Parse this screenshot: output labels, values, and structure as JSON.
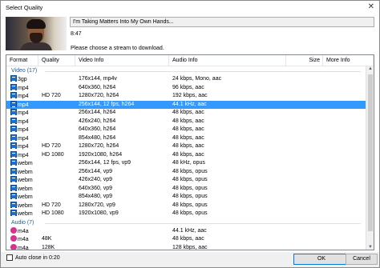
{
  "window": {
    "title": "Select Quality"
  },
  "video": {
    "title": "I'm Taking Matters Into My Own Hands...",
    "duration": "8:47",
    "prompt": "Please choose a stream to download."
  },
  "columns": [
    "Format",
    "Quality",
    "Video Info",
    "Audio Info",
    "Size",
    "More Info"
  ],
  "groups": [
    {
      "label": "Video (17)",
      "icon": "video-file-icon",
      "rows": [
        {
          "format": "3gp",
          "quality": "",
          "video": "176x144, mp4v",
          "audio": "24 kbps, Mono, aac"
        },
        {
          "format": "mp4",
          "quality": "",
          "video": "640x360, h264",
          "audio": "96 kbps, aac"
        },
        {
          "format": "mp4",
          "quality": "HD 720",
          "video": "1280x720, h264",
          "audio": "192 kbps, aac"
        },
        {
          "format": "mp4",
          "quality": "",
          "video": "256x144, 12 fps, h264",
          "audio": "44.1 kHz, aac",
          "selected": true
        },
        {
          "format": "mp4",
          "quality": "",
          "video": "256x144, h264",
          "audio": "48 kbps, aac"
        },
        {
          "format": "mp4",
          "quality": "",
          "video": "426x240, h264",
          "audio": "48 kbps, aac"
        },
        {
          "format": "mp4",
          "quality": "",
          "video": "640x360, h264",
          "audio": "48 kbps, aac"
        },
        {
          "format": "mp4",
          "quality": "",
          "video": "854x480, h264",
          "audio": "48 kbps, aac"
        },
        {
          "format": "mp4",
          "quality": "HD 720",
          "video": "1280x720, h264",
          "audio": "48 kbps, aac"
        },
        {
          "format": "mp4",
          "quality": "HD 1080",
          "video": "1920x1080, h264",
          "audio": "48 kbps, aac"
        },
        {
          "format": "webm",
          "quality": "",
          "video": "256x144, 12 fps, vp9",
          "audio": "48 kHz, opus"
        },
        {
          "format": "webm",
          "quality": "",
          "video": "256x144, vp9",
          "audio": "48 kbps, opus"
        },
        {
          "format": "webm",
          "quality": "",
          "video": "426x240, vp9",
          "audio": "48 kbps, opus"
        },
        {
          "format": "webm",
          "quality": "",
          "video": "640x360, vp9",
          "audio": "48 kbps, opus"
        },
        {
          "format": "webm",
          "quality": "",
          "video": "854x480, vp9",
          "audio": "48 kbps, opus"
        },
        {
          "format": "webm",
          "quality": "HD 720",
          "video": "1280x720, vp9",
          "audio": "48 kbps, opus"
        },
        {
          "format": "webm",
          "quality": "HD 1080",
          "video": "1920x1080, vp9",
          "audio": "48 kbps, opus"
        }
      ]
    },
    {
      "label": "Audio (7)",
      "icon": "audio-file-icon",
      "rows": [
        {
          "format": "m4a",
          "quality": "",
          "video": "",
          "audio": "44.1 kHz, aac"
        },
        {
          "format": "m4a",
          "quality": "48K",
          "video": "",
          "audio": "48 kbps, aac"
        },
        {
          "format": "m4a",
          "quality": "128K",
          "video": "",
          "audio": "128 kbps, aac"
        }
      ]
    }
  ],
  "footer": {
    "auto_close": "Auto close in 0:20",
    "ok": "OK",
    "cancel": "Cancel"
  },
  "colors": {
    "selection": "#3399ff",
    "group_header": "#1e5aa8",
    "audio_icon": "#d9328c",
    "video_icon": "#1d6fcf"
  }
}
